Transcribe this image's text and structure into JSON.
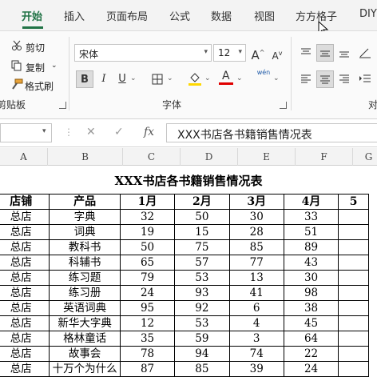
{
  "tabs": [
    "开始",
    "插入",
    "页面布局",
    "公式",
    "数据",
    "视图",
    "方方格子",
    "DIY"
  ],
  "clipboard": {
    "cut": "剪切",
    "copy": "复制",
    "format_painter": "格式刷",
    "group_label": "剪贴板"
  },
  "font": {
    "name": "宋体",
    "size": "12",
    "group_label": "字体",
    "grow": "A",
    "shrink": "A",
    "bold": "B",
    "italic": "I",
    "underline": "U",
    "font_color_letter": "A",
    "fill_letter": "A",
    "wen_label": "wén"
  },
  "alignment": {
    "group_label": "对"
  },
  "formula_bar": {
    "fx": "fx",
    "value": "XXX书店各书籍销售情况表"
  },
  "columns": [
    "A",
    "B",
    "C",
    "D",
    "E",
    "F",
    "G"
  ],
  "sheet": {
    "title": "XXX书店各书籍销售情况表",
    "headers": [
      "店铺",
      "产品",
      "1月",
      "2月",
      "3月",
      "4月",
      "5"
    ],
    "rows": [
      [
        "总店",
        "字典",
        "32",
        "50",
        "30",
        "33",
        ""
      ],
      [
        "总店",
        "词典",
        "19",
        "15",
        "28",
        "51",
        ""
      ],
      [
        "总店",
        "教科书",
        "50",
        "75",
        "85",
        "89",
        ""
      ],
      [
        "总店",
        "科辅书",
        "65",
        "57",
        "77",
        "43",
        ""
      ],
      [
        "总店",
        "练习题",
        "79",
        "53",
        "13",
        "30",
        ""
      ],
      [
        "总店",
        "练习册",
        "24",
        "93",
        "41",
        "98",
        ""
      ],
      [
        "总店",
        "英语词典",
        "95",
        "92",
        "6",
        "38",
        ""
      ],
      [
        "总店",
        "新华大字典",
        "12",
        "53",
        "4",
        "45",
        ""
      ],
      [
        "总店",
        "格林童话",
        "35",
        "59",
        "3",
        "64",
        ""
      ],
      [
        "总店",
        "故事会",
        "78",
        "94",
        "74",
        "22",
        ""
      ],
      [
        "总店",
        "十万个为什么",
        "87",
        "85",
        "39",
        "24",
        ""
      ]
    ]
  },
  "colors": {
    "accent": "#217346",
    "font_color": "#e00000",
    "fill_color": "#ffd800"
  }
}
